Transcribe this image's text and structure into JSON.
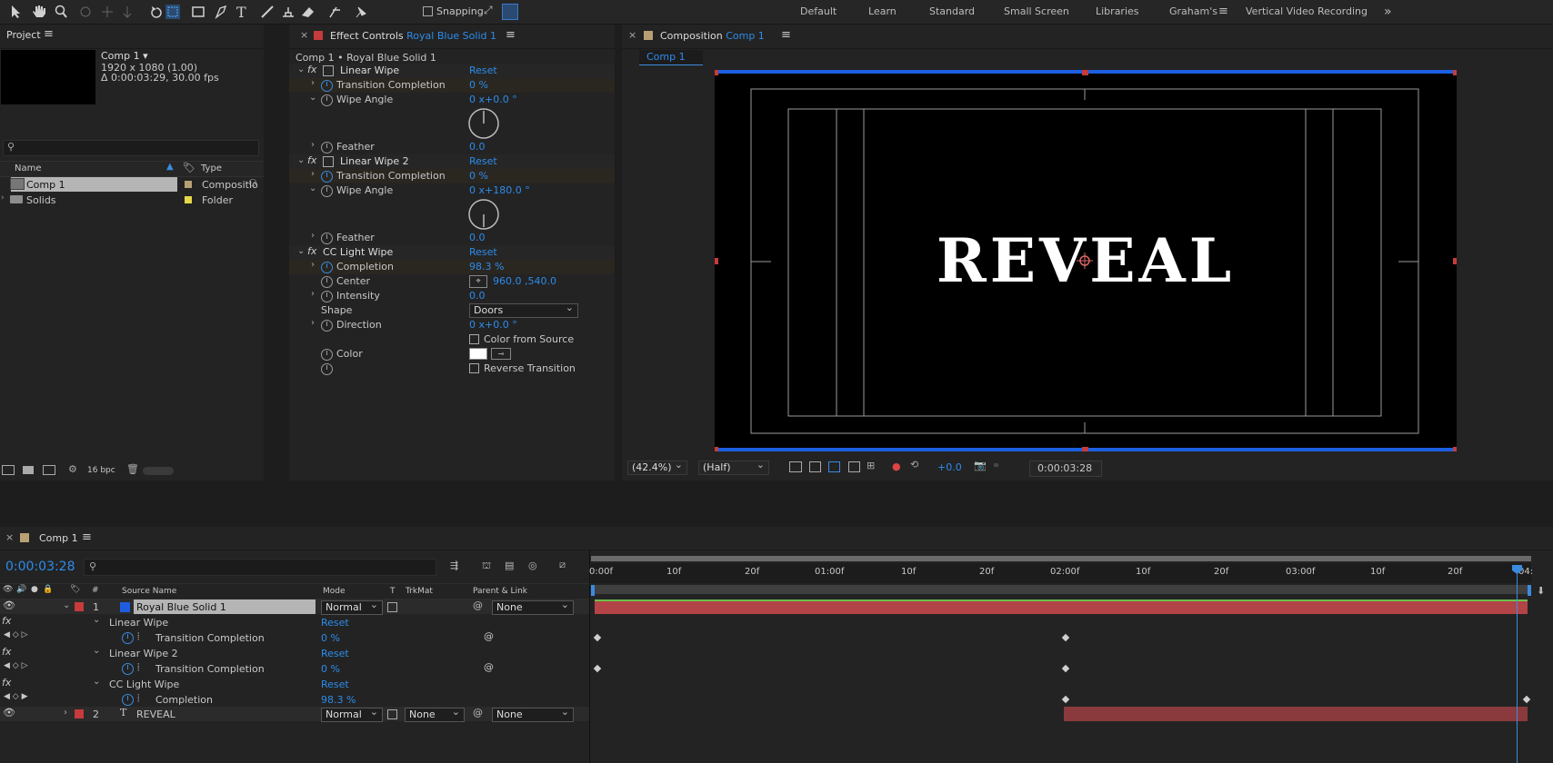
{
  "toolbar": {
    "snapping": "Snapping",
    "workspaces": [
      "Default",
      "Learn",
      "Standard",
      "Small Screen",
      "Libraries",
      "Graham's",
      "Vertical Video Recording"
    ],
    "active_workspace": "Graham's",
    "more": "»"
  },
  "project": {
    "title": "Project",
    "comp_name": "Comp 1",
    "comp_res": "1920 x 1080 (1.00)",
    "comp_duration": "Δ 0:00:03:29, 30.00 fps",
    "search_placeholder": "",
    "col_name": "Name",
    "col_type": "Type",
    "items": [
      {
        "name": "Comp 1",
        "type": "Compositio",
        "color": "#b8a074"
      },
      {
        "name": "Solids",
        "type": "Folder",
        "color": "#e4d84a"
      }
    ],
    "bpc": "16 bpc"
  },
  "effects": {
    "tab_label": "Effect Controls",
    "tab_target": "Royal Blue Solid 1",
    "breadcrumb": "Comp 1 • Royal Blue Solid 1",
    "linear_wipe": {
      "name": "Linear Wipe",
      "reset": "Reset",
      "transition_label": "Transition Completion",
      "transition_value": "0 %",
      "angle_label": "Wipe Angle",
      "angle_value": "0 x+0.0 °",
      "feather_label": "Feather",
      "feather_value": "0.0"
    },
    "linear_wipe2": {
      "name": "Linear Wipe 2",
      "reset": "Reset",
      "transition_label": "Transition Completion",
      "transition_value": "0 %",
      "angle_label": "Wipe Angle",
      "angle_value": "0 x+180.0 °",
      "feather_label": "Feather",
      "feather_value": "0.0"
    },
    "cc_light_wipe": {
      "name": "CC Light Wipe",
      "reset": "Reset",
      "completion_label": "Completion",
      "completion_value": "98.3 %",
      "center_label": "Center",
      "center_value": "960.0 ,540.0",
      "intensity_label": "Intensity",
      "intensity_value": "0.0",
      "shape_label": "Shape",
      "shape_value": "Doors",
      "direction_label": "Direction",
      "direction_value": "0 x+0.0 °",
      "color_from_source": "Color from Source",
      "color_label": "Color",
      "reverse": "Reverse Transition"
    }
  },
  "composition": {
    "tab_label": "Composition",
    "tab_target": "Comp 1",
    "subtab": "Comp 1",
    "canvas_text": "REVEAL",
    "zoom": "(42.4%)",
    "resolution": "(Half)",
    "exposure": "+0.0",
    "timecode": "0:00:03:28"
  },
  "timeline": {
    "tab": "Comp 1",
    "timecode": "0:00:03:28",
    "cols": {
      "source": "Source Name",
      "mode": "Mode",
      "t": "T",
      "trkmat": "TrkMat",
      "parent": "Parent & Link"
    },
    "ruler": [
      "0:00f",
      "10f",
      "20f",
      "01:00f",
      "10f",
      "20f",
      "02:00f",
      "10f",
      "20f",
      "03:00f",
      "10f",
      "20f",
      "04:"
    ],
    "layer1": {
      "num": "1",
      "name": "Royal Blue Solid 1",
      "mode": "Normal",
      "parent": "None",
      "color": "#c63b3b"
    },
    "fx1": {
      "name": "Linear Wipe",
      "reset": "Reset",
      "prop": "Transition Completion",
      "value": "0 %"
    },
    "fx2": {
      "name": "Linear Wipe 2",
      "reset": "Reset",
      "prop": "Transition Completion",
      "value": "0 %"
    },
    "fx3": {
      "name": "CC Light Wipe",
      "reset": "Reset",
      "prop": "Completion",
      "value": "98.3 %"
    },
    "layer2": {
      "num": "2",
      "name": "REVEAL",
      "mode": "Normal",
      "trkmat": "None",
      "parent": "None",
      "color": "#c63b3b"
    }
  }
}
